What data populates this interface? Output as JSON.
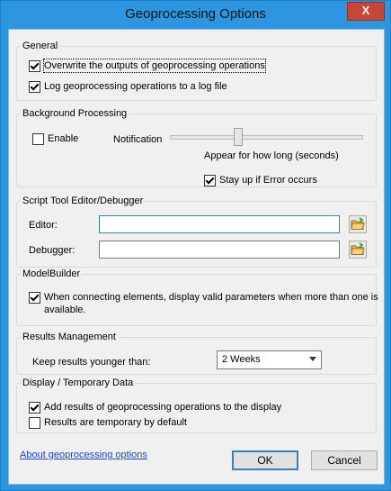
{
  "window": {
    "title": "Geoprocessing Options",
    "close_label": "X"
  },
  "general": {
    "legend": "General",
    "overwrite": {
      "label": "Overwrite the outputs of geoprocessing operations",
      "checked": true
    },
    "log": {
      "label": "Log geoprocessing operations to a log file",
      "checked": true
    }
  },
  "background": {
    "legend": "Background Processing",
    "enable": {
      "label": "Enable",
      "checked": false
    },
    "notification_label": "Notification",
    "slider_caption": "Appear for how long (seconds)",
    "slider_level": 0.35,
    "stay_up": {
      "label": "Stay up if Error occurs",
      "checked": true
    }
  },
  "script_tool": {
    "legend": "Script Tool Editor/Debugger",
    "editor_label": "Editor:",
    "editor_value": "",
    "debugger_label": "Debugger:",
    "debugger_value": ""
  },
  "modelbuilder": {
    "legend": "ModelBuilder",
    "display_valid": {
      "label_line1": "When connecting elements, display valid parameters when more than one is",
      "label_line2": "available.",
      "checked": true
    }
  },
  "results": {
    "legend": "Results Management",
    "keep_label": "Keep results younger than:",
    "keep_value": "2 Weeks"
  },
  "display": {
    "legend": "Display / Temporary Data",
    "add_results": {
      "label": "Add results of geoprocessing operations to the display",
      "checked": true
    },
    "temporary": {
      "label": "Results are temporary by default",
      "checked": false
    }
  },
  "footer": {
    "about_link": "About geoprocessing options",
    "ok_label": "OK",
    "cancel_label": "Cancel"
  },
  "colors": {
    "title_bar": "#2c97e0",
    "close_button": "#c7463a",
    "client_bg": "#f0f0f0",
    "link": "#1a44cc"
  },
  "icons": {
    "browse": "folder-open-icon",
    "close": "close-icon",
    "dropdown": "chevron-down-icon"
  }
}
